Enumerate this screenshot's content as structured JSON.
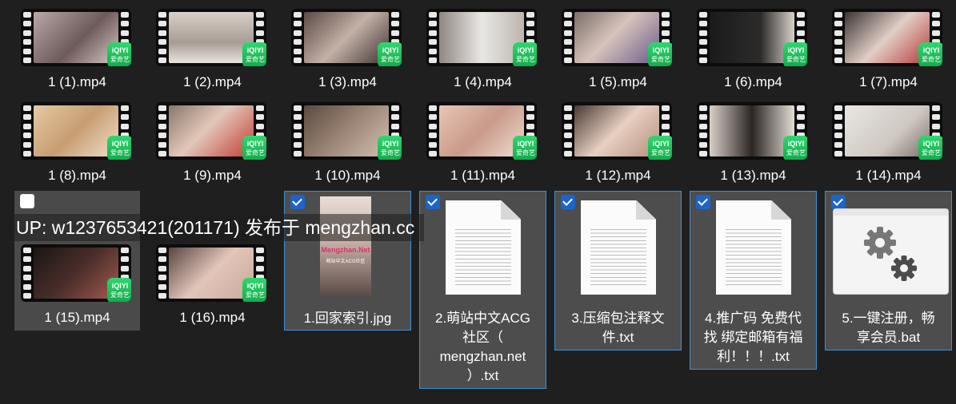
{
  "files": [
    {
      "name": "1 (1).mp4",
      "badge_top": "iQIYI",
      "badge_bottom": "爱奇艺"
    },
    {
      "name": "1 (2).mp4",
      "badge_top": "iQIYI",
      "badge_bottom": "爱奇艺"
    },
    {
      "name": "1 (3).mp4",
      "badge_top": "iQIYI",
      "badge_bottom": "爱奇艺"
    },
    {
      "name": "1 (4).mp4",
      "badge_top": "iQIYI",
      "badge_bottom": "爱奇艺"
    },
    {
      "name": "1 (5).mp4",
      "badge_top": "iQIYI",
      "badge_bottom": "爱奇艺"
    },
    {
      "name": "1 (6).mp4",
      "badge_top": "iQIYI",
      "badge_bottom": "爱奇艺"
    },
    {
      "name": "1 (7).mp4",
      "badge_top": "iQIYI",
      "badge_bottom": "爱奇艺"
    },
    {
      "name": "1 (8).mp4",
      "badge_top": "iQIYI",
      "badge_bottom": "爱奇艺"
    },
    {
      "name": "1 (9).mp4",
      "badge_top": "iQIYI",
      "badge_bottom": "爱奇艺"
    },
    {
      "name": "1 (10).mp4",
      "badge_top": "iQIYI",
      "badge_bottom": "爱奇艺"
    },
    {
      "name": "1 (11).mp4",
      "badge_top": "iQIYI",
      "badge_bottom": "爱奇艺"
    },
    {
      "name": "1 (12).mp4",
      "badge_top": "iQIYI",
      "badge_bottom": "爱奇艺"
    },
    {
      "name": "1 (13).mp4",
      "badge_top": "iQIYI",
      "badge_bottom": "爱奇艺"
    },
    {
      "name": "1 (14).mp4",
      "badge_top": "iQIYI",
      "badge_bottom": "爱奇艺"
    },
    {
      "name": "1 (15).mp4",
      "badge_top": "iQIYI",
      "badge_bottom": "爱奇艺"
    },
    {
      "name": "1 (16).mp4",
      "badge_top": "iQIYI",
      "badge_bottom": "爱奇艺"
    },
    {
      "name": "1.回家索引.jpg",
      "thumb_top": "Mengzhan.Net",
      "thumb_bottom": "萌站中文ACG社区"
    },
    {
      "name": "2.萌站中文ACG社区（mengzhan.net）.txt",
      "lines": [
        "2.萌站中文ACG",
        "社区（",
        "mengzhan.net",
        "）.txt"
      ]
    },
    {
      "name": "3.压缩包注释文件.txt",
      "lines": [
        "3.压缩包注释文",
        "件.txt"
      ]
    },
    {
      "name": "4.推广码 免费代找 绑定邮箱有福利！！！.txt",
      "lines": [
        "4.推广码 免费代",
        "找 绑定邮箱有福",
        "利！！！.txt"
      ]
    },
    {
      "name": "5.一键注册，畅享会员.bat",
      "lines": [
        "5.一键注册，畅",
        "享会员.bat"
      ]
    }
  ],
  "overlay_text": "UP: w1237653421(201171) 发布于 mengzhan.cc",
  "colors": {
    "background": "#1f1f1f",
    "selection_border": "#3e8ed6",
    "checkbox": "#1d64c8",
    "badge": "#1fbf5c"
  },
  "icons": {
    "video": "film-strip-icon",
    "text": "text-document-icon",
    "batch": "gear-settings-icon"
  }
}
